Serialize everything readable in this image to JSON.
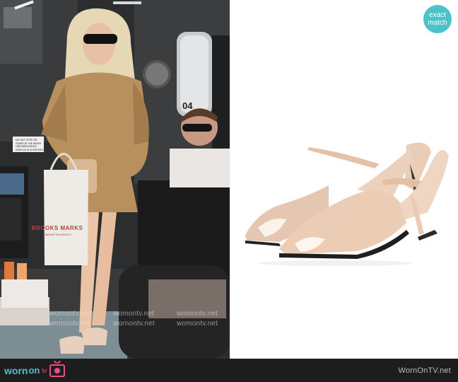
{
  "photo": {
    "alt": "Woman in snakeskin print dress stepping off a bus carrying a tote bag",
    "bag_brand": "BROOKS MARKS",
    "bag_tagline": "MANHATTAN BEACH",
    "sign_text": "DO NOT STOP OR STAND IN THE WHITE LINE AREA WHILE VEHICLE IS IN MOTION",
    "bus_number": "04",
    "watermarks": [
      "womontv.net",
      "womontv.net",
      "womontv.net",
      "womontv.net",
      "wornontv.net",
      "womontv.net"
    ]
  },
  "product": {
    "alt": "Nude leather sculpted-heel mule sandals",
    "color": "#e8c9b3"
  },
  "badge": {
    "line1": "exact",
    "line2": "match"
  },
  "footer": {
    "brand_worn": "worn",
    "brand_on": "on",
    "brand_tv": "tv",
    "site": "WornOnTV.net"
  },
  "colors": {
    "accent_teal": "#4cc3c9",
    "accent_pink": "#e84e8a",
    "footer_bg": "#1d1d1d"
  }
}
